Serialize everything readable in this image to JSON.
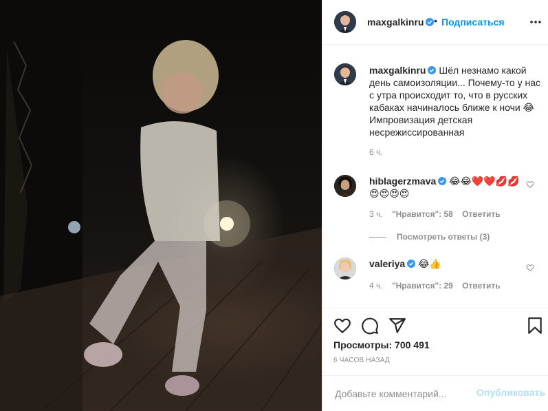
{
  "media": {
    "description_icon": "video-frame"
  },
  "header": {
    "username": "maxgalkinru",
    "separator": "•",
    "follow_label": "Подписаться",
    "more_icon": "more-options-icon"
  },
  "caption": {
    "username": "maxgalkinru",
    "text": "Шёл незнамо какой день самоизоляции... Почему-то у нас с утра происходит то, что в русских кабаках начиналось ближе к ночи 😂 Импровизация детская несрежиссированная",
    "time": "6 ч."
  },
  "comments": [
    {
      "username": "hiblagerzmava",
      "text": "😂😂❤️❤️💋💋😍😍😍😍",
      "time": "3 ч.",
      "likes": "\"Нравится\": 58",
      "reply": "Ответить"
    },
    {
      "username": "valeriya",
      "text": "😂👍",
      "time": "4 ч.",
      "likes": "\"Нравится\": 29",
      "reply": "Ответить"
    }
  ],
  "view_replies": "Посмотреть ответы (3)",
  "actions": {
    "views": "Просмотры: 700 491",
    "posted_ago": "6 ЧАСОВ НАЗАД"
  },
  "add_comment": {
    "placeholder": "Добавьте комментарий...",
    "publish_label": "Опубликовать"
  },
  "colors": {
    "accent": "#0095f6",
    "verified": "#3897f0",
    "muted": "#8e8e8e",
    "publish_disabled": "#b2dffc"
  }
}
